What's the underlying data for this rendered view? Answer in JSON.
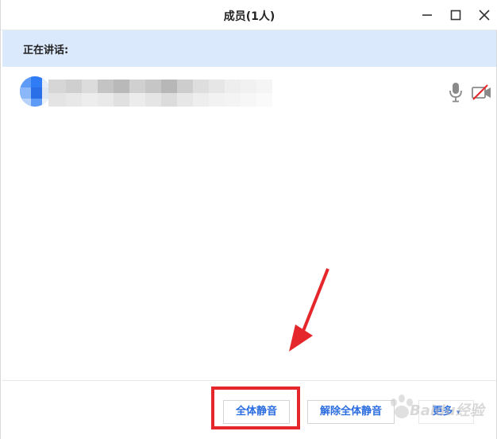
{
  "window": {
    "title": "成员(1人)"
  },
  "speaking": {
    "label": "正在讲话:"
  },
  "member": {
    "mic_state": "microphone-icon",
    "camera_state": "camera-off-icon"
  },
  "footer": {
    "mute_all_label": "全体静音",
    "unmute_all_label": "解除全体静音",
    "more_label": "更多"
  },
  "watermark": {
    "text": "Baidu经验"
  },
  "colors": {
    "accent": "#2b6de0",
    "speaking_bar": "#dbe9fd",
    "highlight": "#e5262a",
    "avatar": "#2f7cf6"
  }
}
